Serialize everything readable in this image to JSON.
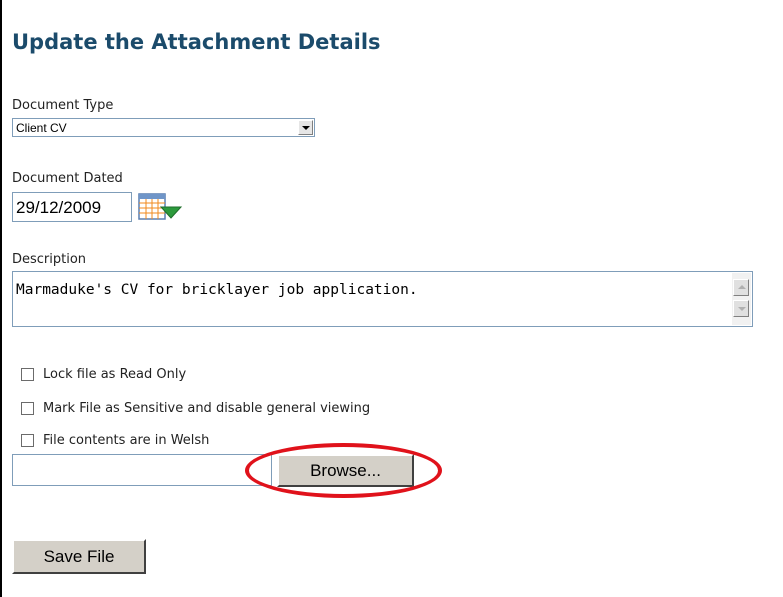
{
  "form": {
    "title": "Update the Attachment Details",
    "document_type_label": "Document Type",
    "document_type_value": "Client CV",
    "document_dated_label": "Document Dated",
    "document_dated_value": "29/12/2009",
    "description_label": "Description",
    "description_value": "Marmaduke's CV for bricklayer job application.",
    "checkboxes": [
      {
        "label": "Lock file as Read Only",
        "checked": false
      },
      {
        "label": "Mark File as Sensitive and disable general viewing",
        "checked": false
      },
      {
        "label": "File contents are in Welsh",
        "checked": false
      }
    ],
    "file_path_value": "",
    "browse_label": "Browse...",
    "save_label": "Save File"
  },
  "icons": {
    "calendar": "calendar-icon",
    "dropdown": "chevron-down-icon",
    "scroll_up": "scroll-up-icon",
    "scroll_down": "scroll-down-icon"
  },
  "colors": {
    "title": "#1b4b6b",
    "highlight_oval": "#e0121b",
    "button_face": "#d4d0c8",
    "input_border": "#7f9db9"
  }
}
